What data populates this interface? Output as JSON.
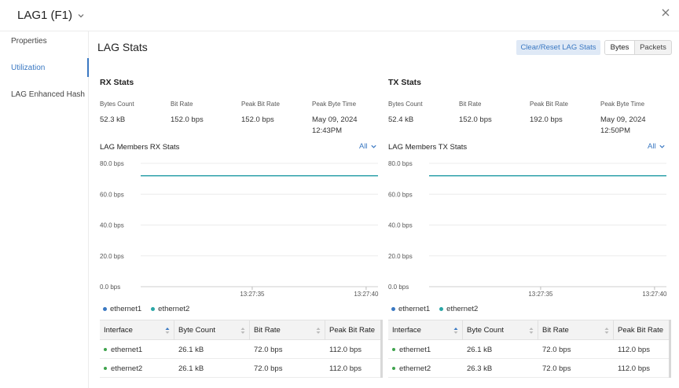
{
  "header": {
    "title": "LAG1 (F1)"
  },
  "sidebar": {
    "items": [
      {
        "label": "Properties",
        "active": false
      },
      {
        "label": "Utilization",
        "active": true
      },
      {
        "label": "LAG Enhanced Hash",
        "active": false
      }
    ]
  },
  "main": {
    "title": "LAG Stats",
    "clear_label": "Clear/Reset LAG Stats",
    "toggle": {
      "bytes": "Bytes",
      "packets": "Packets",
      "selected": "Bytes"
    }
  },
  "colors": {
    "accent": "#3a78c2",
    "ethernet1": "#3a78c2",
    "ethernet2": "#2aa6a6",
    "status_up": "#3fa34d"
  },
  "rx": {
    "title": "RX Stats",
    "labels": {
      "bytes": "Bytes Count",
      "rate": "Bit Rate",
      "peak": "Peak Bit Rate",
      "time": "Peak Byte Time"
    },
    "values": {
      "bytes": "52.3 kB",
      "rate": "152.0 bps",
      "peak": "152.0 bps",
      "time_date": "May 09, 2024",
      "time_clock": "12:43PM"
    },
    "members_title": "LAG Members RX Stats",
    "filter": "All"
  },
  "tx": {
    "title": "TX Stats",
    "labels": {
      "bytes": "Bytes Count",
      "rate": "Bit Rate",
      "peak": "Peak Bit Rate",
      "time": "Peak Byte Time"
    },
    "values": {
      "bytes": "52.4 kB",
      "rate": "152.0 bps",
      "peak": "192.0 bps",
      "time_date": "May 09, 2024",
      "time_clock": "12:50PM"
    },
    "members_title": "LAG Members TX Stats",
    "filter": "All"
  },
  "chart_data": [
    {
      "type": "line",
      "y_ticks": [
        "80.0 bps",
        "60.0 bps",
        "40.0 bps",
        "20.0 bps",
        "0.0 bps"
      ],
      "ylim": [
        0,
        80
      ],
      "x_ticks": [
        "13:27:35",
        "13:27:40"
      ],
      "series": [
        {
          "name": "ethernet1",
          "values": [
            72,
            72
          ]
        },
        {
          "name": "ethernet2",
          "values": [
            72,
            72
          ]
        }
      ],
      "grid": true,
      "legend": "bottom-left"
    },
    {
      "type": "line",
      "y_ticks": [
        "80.0 bps",
        "60.0 bps",
        "40.0 bps",
        "20.0 bps",
        "0.0 bps"
      ],
      "ylim": [
        0,
        80
      ],
      "x_ticks": [
        "13:27:35",
        "13:27:40"
      ],
      "series": [
        {
          "name": "ethernet1",
          "values": [
            72,
            72
          ]
        },
        {
          "name": "ethernet2",
          "values": [
            72,
            72
          ]
        }
      ],
      "grid": true,
      "legend": "bottom-left"
    }
  ],
  "rx_table": {
    "columns": [
      "Interface",
      "Byte Count",
      "Bit Rate",
      "Peak Bit Rate"
    ],
    "rows": [
      [
        "ethernet1",
        "26.1 kB",
        "72.0 bps",
        "112.0 bps"
      ],
      [
        "ethernet2",
        "26.1 kB",
        "72.0 bps",
        "112.0 bps"
      ]
    ]
  },
  "tx_table": {
    "columns": [
      "Interface",
      "Byte Count",
      "Bit Rate",
      "Peak Bit Rate"
    ],
    "rows": [
      [
        "ethernet1",
        "26.1 kB",
        "72.0 bps",
        "112.0 bps"
      ],
      [
        "ethernet2",
        "26.3 kB",
        "72.0 bps",
        "112.0 bps"
      ]
    ]
  }
}
